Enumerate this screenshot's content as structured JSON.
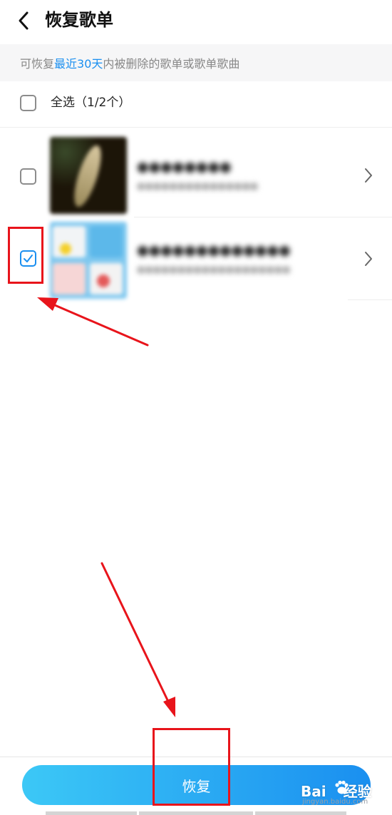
{
  "header": {
    "back_icon": "chevron-left-icon",
    "title": "恢复歌单"
  },
  "notice": {
    "prefix": "可恢复",
    "highlight": "最近30天",
    "suffix": "内被删除的歌单或歌单歌曲",
    "highlight_color": "#1a8ff0"
  },
  "select_all": {
    "label": "全选（1/2个）",
    "checked": false
  },
  "playlists": [
    {
      "title": "●●●●●●●●",
      "subtitle": "●●●●●●●●●●●●●●●",
      "checked": false,
      "chevron_icon": "chevron-right-icon"
    },
    {
      "title": "●●●●●●●●●●●●●",
      "subtitle": "●●●●●●●●●●●●●●●●●●●",
      "checked": true,
      "chevron_icon": "chevron-right-icon"
    }
  ],
  "footer": {
    "restore_label": "恢复"
  },
  "watermark": {
    "brand_prefix": "Bai",
    "brand_suffix": "经验",
    "url": "jingyan.baidu.com"
  },
  "colors": {
    "accent": "#1a8ff0",
    "button_gradient_start": "#3cc8f6",
    "button_gradient_end": "#1a8ff0",
    "annotation_red": "#e8141b"
  }
}
